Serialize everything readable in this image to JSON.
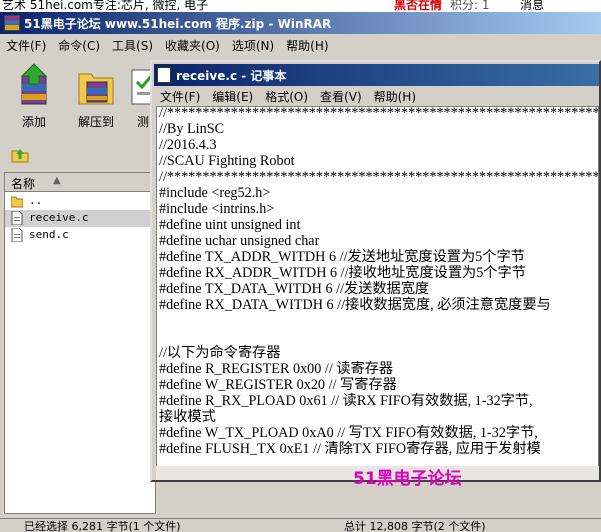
{
  "background_page": {
    "strip_left": "艺术  51hei.com专注:芯片, 微控, 电子",
    "strip_right_red": "黑否在情",
    "strip_right_gray": "积分: 1",
    "strip_right_msg": "消息"
  },
  "winrar": {
    "title": "51黑电子论坛  www.51hei.com 程序.zip - WinRAR",
    "menu": [
      "文件(F)",
      "命令(C)",
      "工具(S)",
      "收藏夹(O)",
      "选项(N)",
      "帮助(H)"
    ],
    "toolbar": [
      "添加",
      "解压到",
      "测"
    ],
    "list_header": "名称",
    "files": [
      "..",
      "receive.c",
      "send.c"
    ],
    "status_left": "已经选择 6,281 字节(1 个文件)",
    "status_right": "总计 12,808 字节(2 个文件)"
  },
  "notepad": {
    "title": "receive.c - 记事本",
    "menu": [
      "文件(F)",
      "编辑(E)",
      "格式(O)",
      "查看(V)",
      "帮助(H)"
    ],
    "lines": [
      "//********************************************************************",
      "//By LinSC",
      "//2016.4.3",
      "//SCAU Fighting Robot",
      "//********************************************************************",
      "#include <reg52.h>",
      "#include <intrins.h>",
      "#define uint unsigned int",
      "#define uchar unsigned char",
      "#define TX_ADDR_WITDH 6 //发送地址宽度设置为5个字节",
      "#define RX_ADDR_WITDH 6 //接收地址宽度设置为5个字节",
      "#define TX_DATA_WITDH 6 //发送数据宽度",
      "#define RX_DATA_WITDH 6 //接收数据宽度, 必须注意宽度要与",
      "",
      "",
      "//以下为命令寄存器",
      "#define R_REGISTER 0x00 // 读寄存器",
      "#define W_REGISTER 0x20 // 写寄存器",
      "#define R_RX_PLOAD 0x61 // 读RX FIFO有效数据, 1-32字节,",
      "接收模式",
      "#define W_TX_PLOAD 0xA0 // 写TX FIFO有效数据, 1-32字节,",
      "#define FLUSH_TX 0xE1 // 清除TX FIFO寄存器, 应用于发射模"
    ]
  },
  "watermark": "51黑电子论坛"
}
